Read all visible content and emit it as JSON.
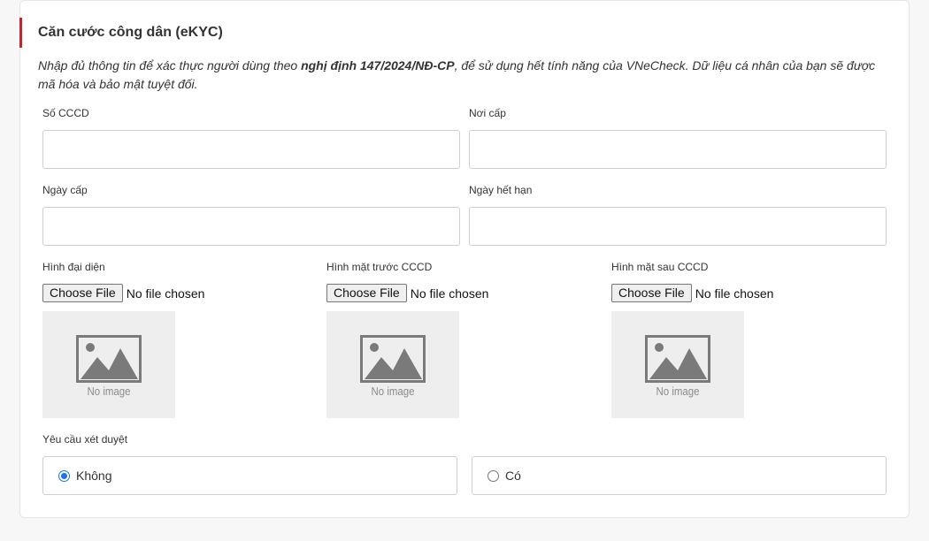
{
  "section": {
    "title": "Căn cước công dân (eKYC)",
    "desc_prefix": "Nhập đủ thông tin để xác thực người dùng theo ",
    "desc_bold": "nghị định 147/2024/NĐ-CP",
    "desc_suffix": ", để sử dụng hết tính năng của VNeCheck. Dữ liệu cá nhân của bạn sẽ được mã hóa và bảo mật tuyệt đối."
  },
  "fields": {
    "so_cccd": {
      "label": "Số CCCD",
      "value": ""
    },
    "noi_cap": {
      "label": "Nơi cấp",
      "value": ""
    },
    "ngay_cap": {
      "label": "Ngày cấp",
      "value": ""
    },
    "ngay_het_han": {
      "label": "Ngày hết hạn",
      "value": ""
    }
  },
  "uploads": [
    {
      "label": "Hình đại diện",
      "button": "Choose File",
      "status": "No file chosen",
      "placeholder": "No image"
    },
    {
      "label": "Hình mặt trước CCCD",
      "button": "Choose File",
      "status": "No file chosen",
      "placeholder": "No image"
    },
    {
      "label": "Hình mặt sau CCCD",
      "button": "Choose File",
      "status": "No file chosen",
      "placeholder": "No image"
    }
  ],
  "review": {
    "label": "Yêu cầu xét duyệt",
    "options": [
      {
        "label": "Không",
        "checked": true
      },
      {
        "label": "Có",
        "checked": false
      }
    ]
  },
  "colors": {
    "accent_bar": "#c8232c",
    "radio_checked": "#1a73e8"
  }
}
